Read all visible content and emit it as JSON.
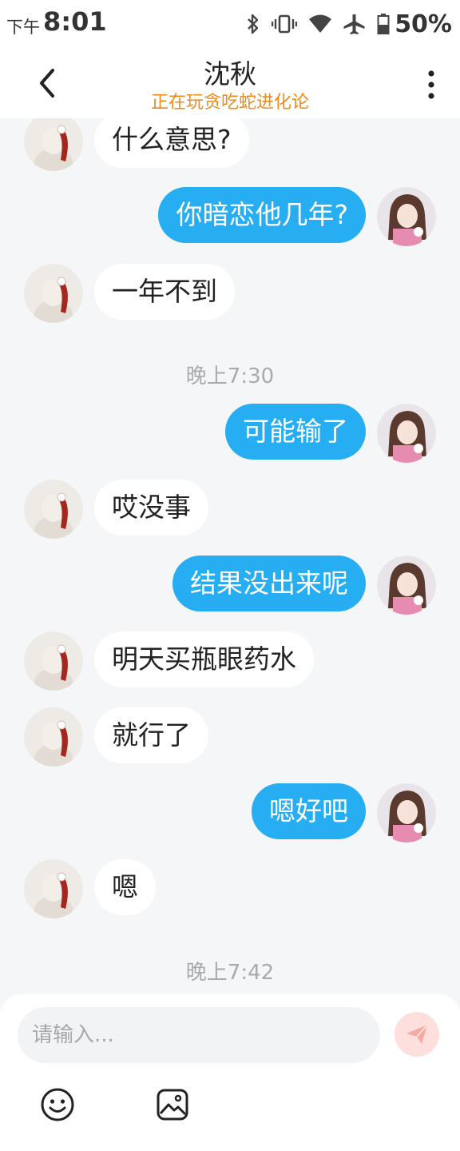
{
  "status_bar": {
    "time_prefix": "下午",
    "time": "8:01",
    "battery": "50%"
  },
  "header": {
    "title": "沈秋",
    "subtitle": "正在玩贪吃蛇进化论"
  },
  "messages": [
    {
      "from": "other",
      "text": "什么意思?"
    },
    {
      "from": "me",
      "text": "你暗恋他几年?"
    },
    {
      "from": "other",
      "text": "一年不到"
    },
    {
      "type": "timestamp",
      "text": "晚上7:30"
    },
    {
      "from": "me",
      "text": "可能输了"
    },
    {
      "from": "other",
      "text": "哎没事"
    },
    {
      "from": "me",
      "text": "结果没出来呢"
    },
    {
      "from": "other",
      "text": "明天买瓶眼药水"
    },
    {
      "from": "other",
      "text": "就行了"
    },
    {
      "from": "me",
      "text": "嗯好吧"
    },
    {
      "from": "other",
      "text": "嗯"
    },
    {
      "type": "timestamp",
      "text": "晚上7:42"
    }
  ],
  "input": {
    "placeholder": "请输入...",
    "value": ""
  },
  "icons": {
    "back": "chevron-left-icon",
    "more": "more-vertical-icon",
    "send": "send-icon",
    "emoji": "emoji-icon",
    "image": "image-icon"
  },
  "colors": {
    "my_bubble": "#27aef2",
    "subtitle": "#f08a1c",
    "background": "#f4f6f8"
  }
}
